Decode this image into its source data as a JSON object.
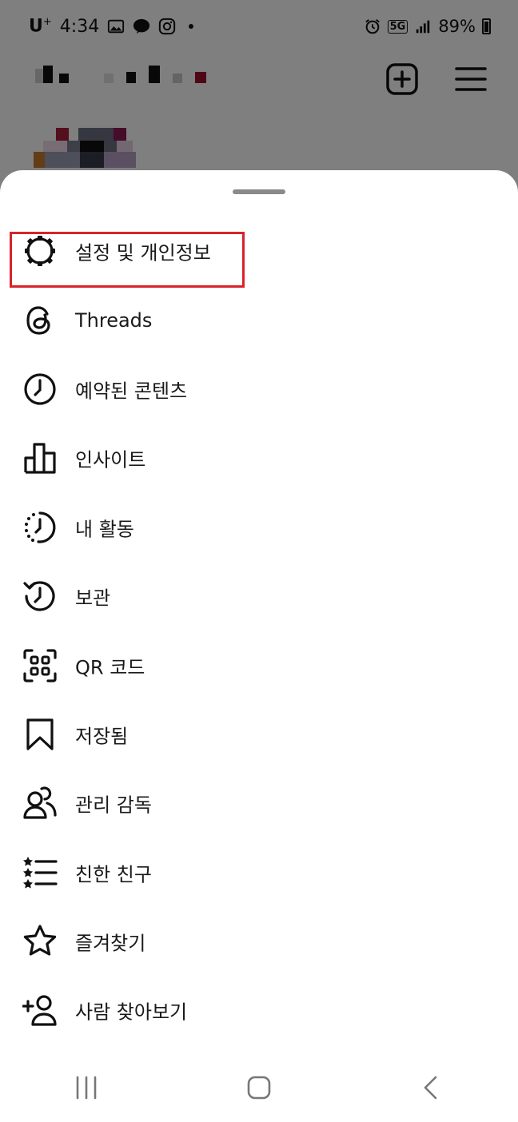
{
  "status_bar": {
    "carrier": "U",
    "carrier_sup": "+",
    "time": "4:34",
    "battery_percent": "89%",
    "network": "5G",
    "icons": [
      "gallery-icon",
      "kakaotalk-icon",
      "instagram-icon",
      "dot-icon",
      "alarm-icon",
      "5g-icon",
      "signal-icon",
      "battery-icon"
    ]
  },
  "header": {
    "actions": [
      "new-post-icon",
      "menu-icon"
    ]
  },
  "menu": {
    "items": [
      {
        "icon": "settings-icon",
        "label": "설정 및 개인정보",
        "highlighted": true
      },
      {
        "icon": "threads-icon",
        "label": "Threads"
      },
      {
        "icon": "clock-icon",
        "label": "예약된 콘텐츠"
      },
      {
        "icon": "insights-icon",
        "label": "인사이트"
      },
      {
        "icon": "activity-icon",
        "label": "내 활동"
      },
      {
        "icon": "archive-icon",
        "label": "보관"
      },
      {
        "icon": "qr-code-icon",
        "label": "QR 코드"
      },
      {
        "icon": "bookmark-icon",
        "label": "저장됨"
      },
      {
        "icon": "supervision-icon",
        "label": "관리 감독"
      },
      {
        "icon": "close-friends-icon",
        "label": "친한 친구"
      },
      {
        "icon": "star-icon",
        "label": "즐겨찾기"
      },
      {
        "icon": "add-person-icon",
        "label": "사람 찾아보기"
      }
    ]
  },
  "highlight_color": "#d8232a",
  "navigation_bar": [
    "recent-apps-icon",
    "home-icon",
    "back-icon"
  ]
}
